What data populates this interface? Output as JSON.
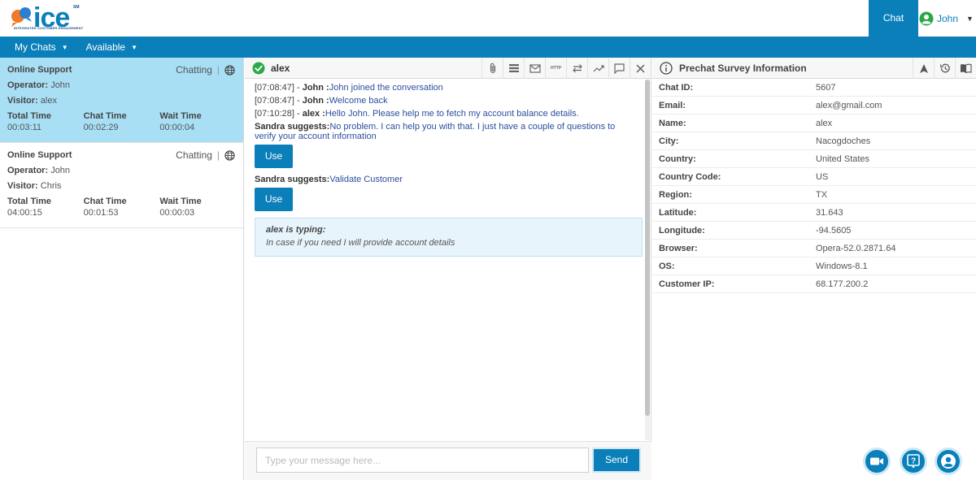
{
  "header": {
    "logo_text": "ice",
    "logo_superscript": "SM",
    "logo_tagline": "INTEGRATED CUSTOMER ENGAGEMENT",
    "active_tab": "Chat",
    "user_name": "John"
  },
  "nav": {
    "my_chats": "My Chats",
    "status": "Available"
  },
  "chats": [
    {
      "queue": "Online Support",
      "status": "Chatting",
      "operator_label": "Operator:",
      "operator": "John",
      "visitor_label": "Visitor:",
      "visitor": "alex",
      "total_label": "Total Time",
      "total": "00:03:11",
      "chat_label": "Chat Time",
      "chat": "00:02:29",
      "wait_label": "Wait Time",
      "wait": "00:00:04"
    },
    {
      "queue": "Online Support",
      "status": "Chatting",
      "operator_label": "Operator:",
      "operator": "John",
      "visitor_label": "Visitor:",
      "visitor": "Chris",
      "total_label": "Total Time",
      "total": "04:00:15",
      "chat_label": "Chat Time",
      "chat": "00:01:53",
      "wait_label": "Wait Time",
      "wait": "00:00:03"
    }
  ],
  "conversation": {
    "visitor_name": "alex",
    "http_tool": "HTTP",
    "messages": [
      {
        "time": "[07:08:47] -",
        "author": "John :",
        "text": "John joined the conversation"
      },
      {
        "time": "[07:08:47] -",
        "author": "John :",
        "text": "Welcome back"
      },
      {
        "time": "[07:10:28] -",
        "author": "alex :",
        "text": "Hello John. Please help me to fetch my account balance details."
      }
    ],
    "suggestions": [
      {
        "author": "Sandra suggests:",
        "text": "No problem. I can help you with that. I just have a couple of questions to verify your account information",
        "button": "Use"
      },
      {
        "author": "Sandra suggests:",
        "text": "Validate Customer",
        "button": "Use"
      }
    ],
    "typing_label": "alex is typing:",
    "typing_text": "In case if you need I will provide account details",
    "input_placeholder": "Type your message here...",
    "send_label": "Send"
  },
  "survey": {
    "title": "Prechat Survey Information",
    "rows": [
      {
        "key": "Chat ID:",
        "value": "5607"
      },
      {
        "key": "Email:",
        "value": "alex@gmail.com"
      },
      {
        "key": "Name:",
        "value": "alex"
      },
      {
        "key": "City:",
        "value": "Nacogdoches"
      },
      {
        "key": "Country:",
        "value": "United States"
      },
      {
        "key": "Country Code:",
        "value": "US"
      },
      {
        "key": "Region:",
        "value": "TX"
      },
      {
        "key": "Latitude:",
        "value": "31.643"
      },
      {
        "key": "Longitude:",
        "value": "-94.5605"
      },
      {
        "key": "Browser:",
        "value": "Opera-52.0.2871.64"
      },
      {
        "key": "OS:",
        "value": "Windows-8.1"
      },
      {
        "key": "Customer IP:",
        "value": "68.177.200.2"
      }
    ]
  },
  "colors": {
    "brand_blue": "#0a7fb9",
    "active_card": "#a8dff5",
    "online_green": "#2aa84a",
    "logo_orange": "#f07a2a"
  },
  "icons": [
    "check-circle-icon",
    "paperclip-icon",
    "list-icon",
    "email-icon",
    "http-icon",
    "transfer-icon",
    "trend-icon",
    "comment-icon",
    "close-icon",
    "info-icon",
    "navigation-icon",
    "history-icon",
    "book-icon",
    "globe-icon",
    "user-circle-icon",
    "video-icon",
    "help-icon",
    "account-icon"
  ]
}
